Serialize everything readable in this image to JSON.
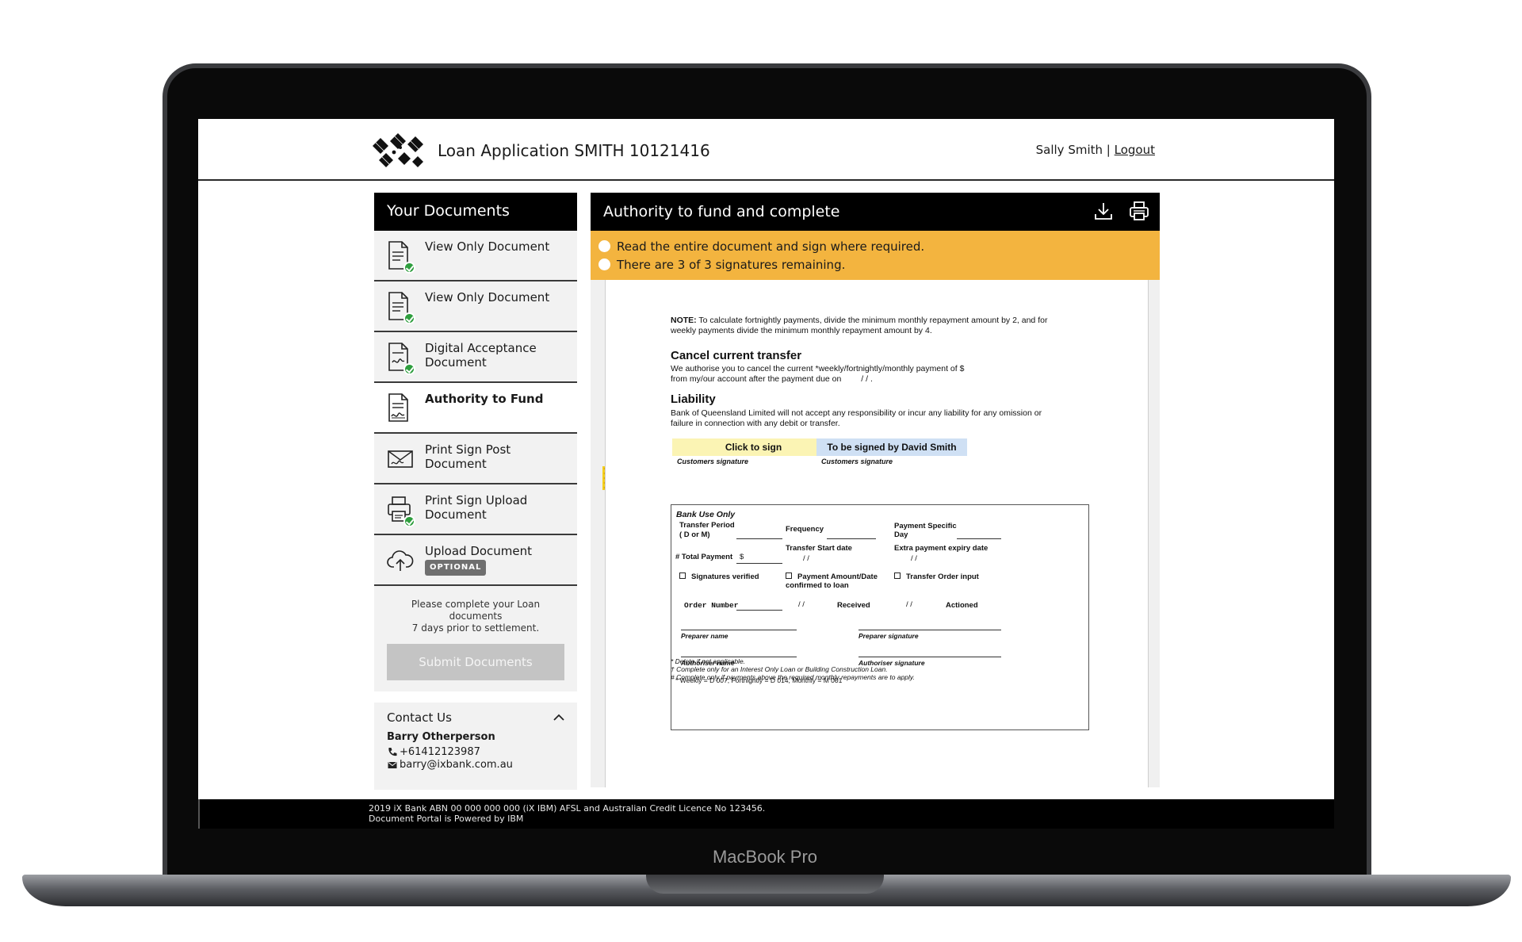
{
  "device": {
    "brand": "MacBook Pro"
  },
  "header": {
    "title": "Loan Application SMITH 10121416",
    "user_name": "Sally Smith",
    "separator": "|",
    "logout_label": "Logout"
  },
  "sidebar": {
    "title": "Your Documents",
    "items": [
      {
        "line1": "View Only Document",
        "line2": "",
        "icon": "document-check-icon",
        "completed": true
      },
      {
        "line1": "View Only Document",
        "line2": "",
        "icon": "document-check-icon",
        "completed": true
      },
      {
        "line1": "Digital Acceptance",
        "line2": "Document",
        "icon": "signed-document-icon",
        "completed": true
      },
      {
        "line1": "Authority to Fund",
        "line2": "",
        "icon": "signature-document-icon",
        "completed": false,
        "active": true
      },
      {
        "line1": "Print Sign Post",
        "line2": "Document",
        "icon": "envelope-signature-icon",
        "completed": false
      },
      {
        "line1": "Print Sign Upload",
        "line2": "Document",
        "icon": "printer-icon",
        "completed": true
      },
      {
        "line1": "Upload Document",
        "line2": "",
        "badge": "OPTIONAL",
        "icon": "cloud-upload-icon",
        "completed": false
      }
    ],
    "complete_message_line1": "Please complete your Loan documents",
    "complete_message_line2": "7 days prior to settlement.",
    "submit_label": "Submit Documents"
  },
  "contact": {
    "title": "Contact Us",
    "name": "Barry Otherperson",
    "phone": "+61412123987",
    "email": "barry@ixbank.com.au"
  },
  "panel": {
    "title": "Authority to fund and complete",
    "notices": [
      "Read the entire document and sign where required.",
      "There are 3 of 3 signatures remaining."
    ]
  },
  "document": {
    "note_label": "NOTE:",
    "note_line1": " To calculate fortnightly payments, divide the minimum monthly repayment amount by 2, and for",
    "note_line2": "weekly payments divide the minimum monthly repayment amount by 4.",
    "cancel_heading": "Cancel current transfer",
    "cancel_line1": "We authorise you to cancel the current *weekly/fortnightly/monthly payment of $",
    "cancel_line2": "from my/our account after the payment due on",
    "cancel_date": "/        /        .",
    "liability_heading": "Liability",
    "liability_line1": "Bank of Queensland Limited will not accept any responsibility or incur any liability for any omission or",
    "liability_line2": "failure in connection with any debit or transfer.",
    "sign_field_1": "Click to sign",
    "sign_field_2": "To be signed by David Smith",
    "sign_caption": "Customers signature",
    "bank_use_title": "Bank Use Only",
    "transfer_period_1": "Transfer Period",
    "transfer_period_2": "( D or M)",
    "frequency": "Frequency",
    "payment_specific_1": "Payment Specific",
    "payment_specific_2": "Day",
    "total_payment": "# Total Payment",
    "dollar": "$",
    "transfer_start": "Transfer Start date",
    "extra_expiry": "Extra payment expiry date",
    "date_slashes": "/      /",
    "signatures_verified": "Signatures verified",
    "payment_confirmed_1": "Payment Amount/Date",
    "payment_confirmed_2": "confirmed to loan",
    "transfer_order_input": "Transfer Order input",
    "order_number": "Order Number",
    "received": "Received",
    "actioned": "Actioned",
    "preparer_name": "Preparer name",
    "preparer_signature": "Preparer signature",
    "authoriser_name": "Authoriser name",
    "authoriser_signature": "Authoriser signature",
    "codes_note": "* Weekly = D 007, Fortnightly = D 014, Monthly = M 001",
    "footnote_1": "* Delete if not applicable.",
    "footnote_2": "† Complete only for an Interest Only Loan or Building Construction Loan.",
    "footnote_3": "# Complete only if payments above the required monthly repayments are to apply."
  },
  "footer": {
    "line1": "2019 iX Bank ABN 00 000 000 000 (iX IBM) AFSL and Australian Credit Licence No 123456.",
    "line2": "Document Portal is Powered by IBM"
  }
}
